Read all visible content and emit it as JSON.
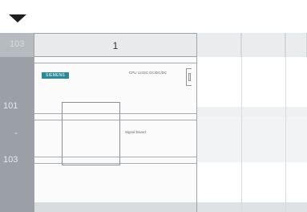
{
  "toolbar": {
    "dropdown_icon": "caret-down-icon"
  },
  "gutter": {
    "header_label": "103",
    "rows": [
      "101",
      "-",
      "103"
    ]
  },
  "columns": {
    "main_header": "1"
  },
  "module": {
    "logo_text": "SIEMENS",
    "cpu_label": "CPU 1215C DC/DC/DC",
    "board_label": "Signal Board"
  }
}
